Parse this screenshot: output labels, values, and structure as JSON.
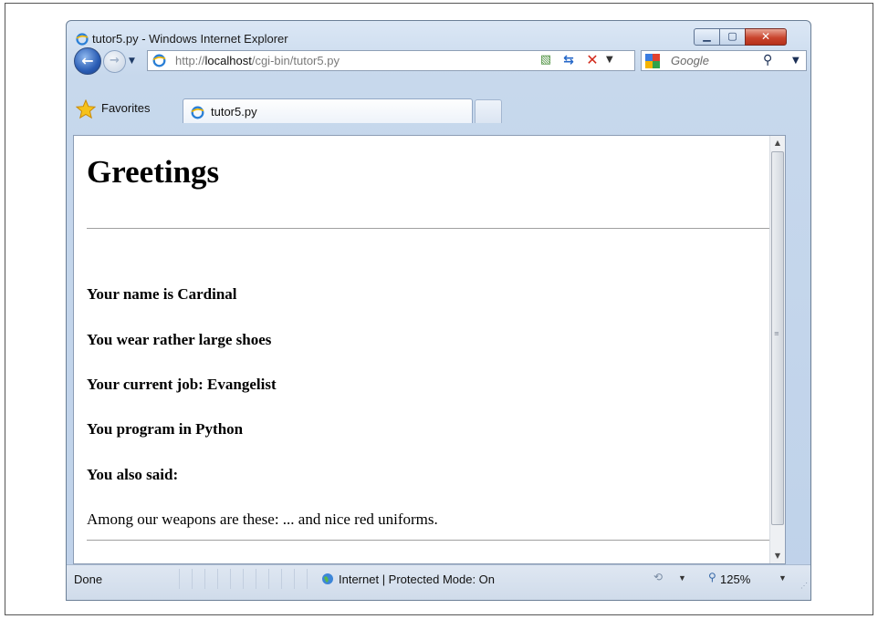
{
  "window": {
    "title": "tutor5.py - Windows Internet Explorer",
    "min_glyph": "▁",
    "max_glyph": "▢",
    "close_glyph": "✕"
  },
  "address_bar": {
    "prefix": "http://",
    "host": "localhost",
    "path": "/cgi-bin/tutor5.py"
  },
  "search": {
    "placeholder": "Google"
  },
  "favorites": {
    "label": "Favorites"
  },
  "tab": {
    "label": "tutor5.py"
  },
  "page": {
    "heading": "Greetings",
    "lines": [
      "Your name is Cardinal",
      "You wear rather large shoes",
      "Your current job: Evangelist",
      "You program in Python",
      "You also said:"
    ],
    "comment": "Among our weapons are these: ... and nice red uniforms."
  },
  "status": {
    "text": "Done",
    "zone": "Internet | Protected Mode: On",
    "zoom": "125%"
  },
  "icons": {
    "back": "back-arrow-icon",
    "forward": "forward-arrow-icon",
    "refresh": "refresh-icon",
    "stop": "stop-icon",
    "search": "search-icon",
    "favorites": "star-icon",
    "globe": "globe-icon"
  },
  "colors": {
    "close_button": "#c9452e",
    "chrome": "#c7d8ec"
  }
}
